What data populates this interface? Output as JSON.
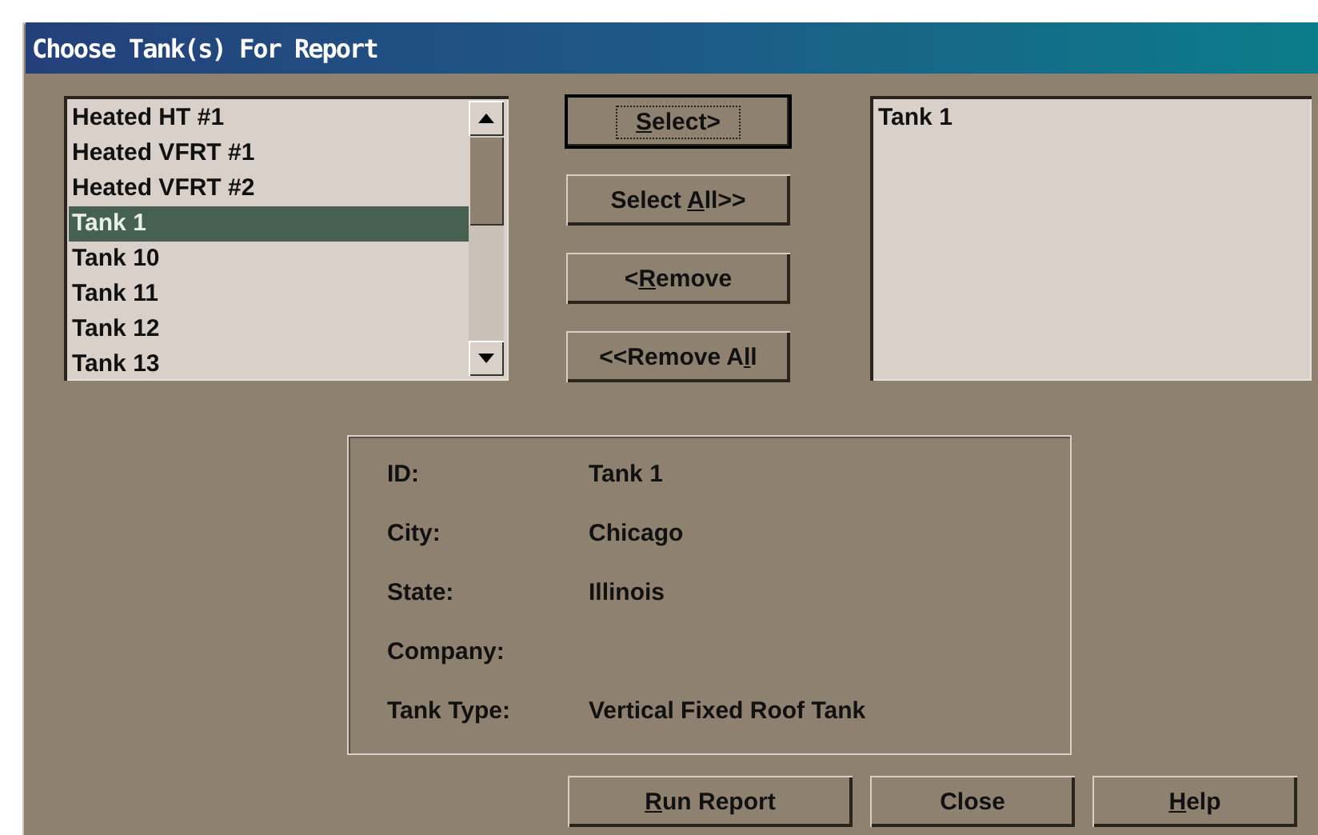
{
  "window": {
    "title": "Choose Tank(s) For Report"
  },
  "available": {
    "items": [
      {
        "label": "Heated HT #1",
        "selected": false
      },
      {
        "label": "Heated VFRT #1",
        "selected": false
      },
      {
        "label": "Heated VFRT #2",
        "selected": false
      },
      {
        "label": "Tank 1",
        "selected": true
      },
      {
        "label": "Tank 10",
        "selected": false
      },
      {
        "label": "Tank 11",
        "selected": false
      },
      {
        "label": "Tank 12",
        "selected": false
      },
      {
        "label": "Tank 13",
        "selected": false
      }
    ]
  },
  "move_buttons": [
    {
      "key": "S",
      "after": "elect>",
      "focused": true
    },
    {
      "before": "Select ",
      "key": "A",
      "after": "ll>>",
      "focused": false
    },
    {
      "before": "<",
      "key": "R",
      "after": "emove",
      "focused": false
    },
    {
      "before": "<<Remove A",
      "key": "l",
      "after": "l",
      "focused": false
    }
  ],
  "chosen": {
    "items": [
      {
        "label": "Tank 1"
      }
    ]
  },
  "details": [
    {
      "label": "ID:",
      "value": "Tank 1"
    },
    {
      "label": "City:",
      "value": "Chicago"
    },
    {
      "label": "State:",
      "value": "Illinois"
    },
    {
      "label": "Company:"
    },
    {
      "label": "Tank Type:",
      "value": "Vertical Fixed Roof Tank"
    }
  ],
  "bottom_buttons": [
    {
      "key": "R",
      "after": "un Report",
      "focused": false
    },
    {
      "before": "Close",
      "focused": false
    },
    {
      "key": "H",
      "after": "elp",
      "focused": false
    }
  ]
}
